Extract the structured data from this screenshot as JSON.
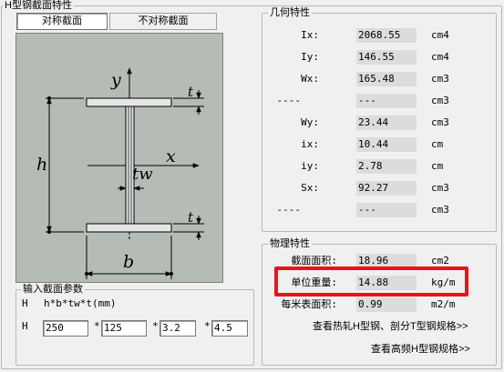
{
  "section_group": {
    "title": "H型钢截面特性"
  },
  "tabs": [
    {
      "label": "对称截面",
      "selected": true
    },
    {
      "label": "不对称截面",
      "selected": false
    }
  ],
  "diagram": {
    "label_y": "y",
    "label_x": "x",
    "label_h": "h",
    "label_b": "b",
    "label_t_top": "t",
    "label_t_bottom": "t",
    "label_tw": "tw",
    "background_color": "#b5bcb5"
  },
  "geometry_group": {
    "title": "几何特性",
    "rows": [
      {
        "label": "Ix:",
        "value": "2068.55",
        "unit": "cm4"
      },
      {
        "label": "Iy:",
        "value": "146.55",
        "unit": "cm4"
      },
      {
        "label": "Wx:",
        "value": "165.48",
        "unit": "cm3"
      },
      {
        "label": "----",
        "value": "---",
        "unit": "cm3"
      },
      {
        "label": "Wy:",
        "value": "23.44",
        "unit": "cm3"
      },
      {
        "label": "ix:",
        "value": "10.44",
        "unit": "cm"
      },
      {
        "label": "iy:",
        "value": "2.78",
        "unit": "cm"
      },
      {
        "label": "Sx:",
        "value": "92.27",
        "unit": "cm3"
      },
      {
        "label": "----",
        "value": "---",
        "unit": "cm3"
      }
    ]
  },
  "physical_group": {
    "title": "物理特性",
    "rows": [
      {
        "label": "截面面积:",
        "value": "18.96",
        "unit": "cm2"
      },
      {
        "label": "单位重量:",
        "value": "14.88",
        "unit": "kg/m"
      },
      {
        "label": "每米表面积:",
        "value": "0.99",
        "unit": "m2/m"
      }
    ],
    "link_hot_rolled": "查看热轧H型钢、剖分T型钢规格>>",
    "link_high_freq": "查看高频H型钢规格>>",
    "highlight_color": "#e8141c"
  },
  "input_group": {
    "title": "输入截面参数",
    "formula_prefix": "H",
    "formula": "h*b*tw*t(mm)",
    "row_prefix": "H",
    "multiply": "*",
    "fields": [
      {
        "name": "h",
        "value": "250"
      },
      {
        "name": "b",
        "value": "125"
      },
      {
        "name": "tw",
        "value": "3.2"
      },
      {
        "name": "t",
        "value": "4.5"
      }
    ]
  }
}
